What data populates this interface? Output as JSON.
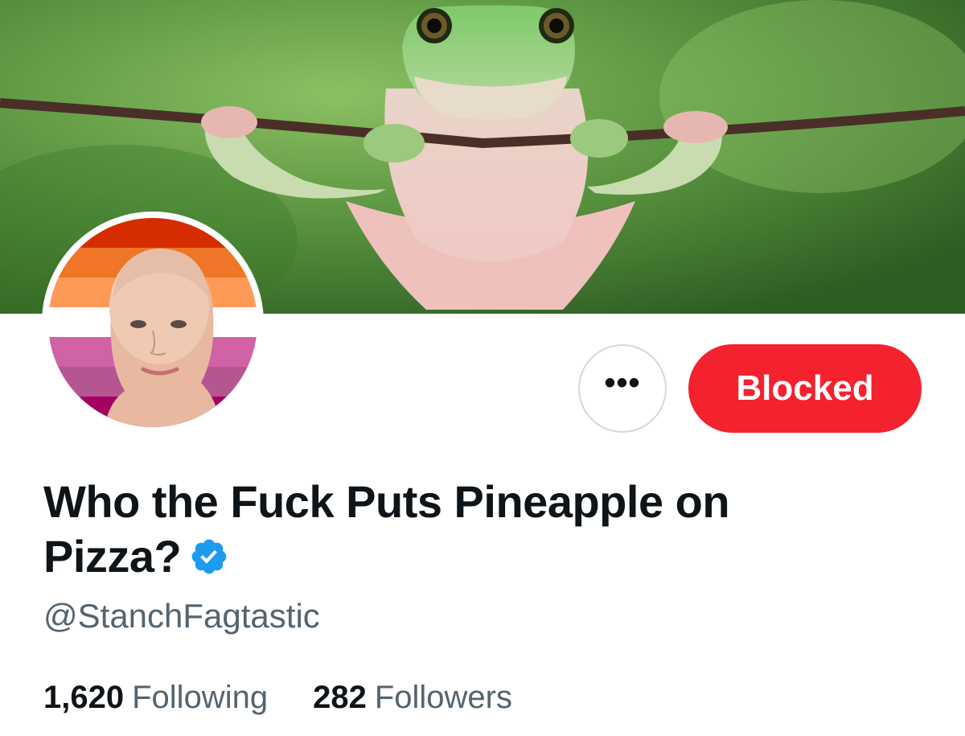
{
  "banner": {
    "image": "frog-hanging-on-wire-photo"
  },
  "avatar": {
    "image": "bald-person-portrait-on-lesbian-flag-stripes",
    "flag_colors": [
      "#d52d00",
      "#ef7627",
      "#ff9a56",
      "#ffffff",
      "#d162a4",
      "#b55690",
      "#a30262"
    ]
  },
  "actions": {
    "more_label": "•••",
    "blocked_label": "Blocked"
  },
  "profile": {
    "name": "Who the Fuck Puts Pineapple on Pizza?",
    "verified_icon": "verified-badge-icon",
    "handle": "@StanchFagtastic"
  },
  "stats": {
    "following_count": "1,620",
    "following_label": "Following",
    "followers_count": "282",
    "followers_label": "Followers"
  },
  "colors": {
    "accent_verified": "#1d9bf0",
    "blocked_red": "#f4212e",
    "text_primary": "#0f1419",
    "text_secondary": "#536471"
  }
}
